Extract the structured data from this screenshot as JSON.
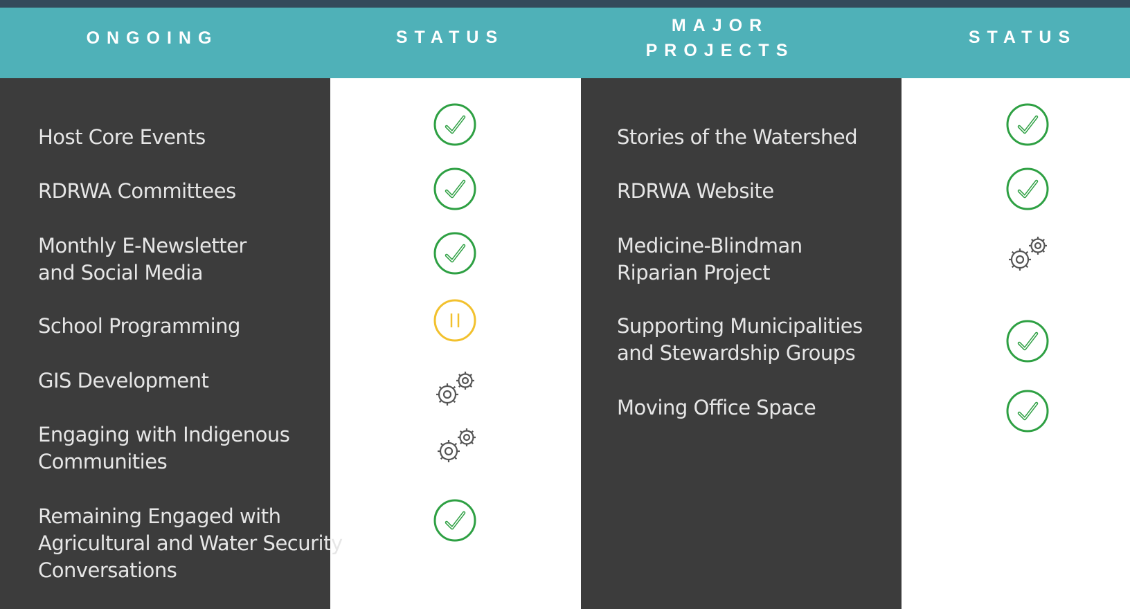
{
  "header": {
    "col1": "ONGOING",
    "col2": "STATUS",
    "col3_line1": "MAJOR",
    "col3_line2": "PROJECTS",
    "col4": "STATUS"
  },
  "colors": {
    "header_bg": "#4fb1b8",
    "top_bar": "#344a5b",
    "dark_panel": "#3c3c3c",
    "complete": "#2ea043",
    "paused": "#f2c12e",
    "in_progress": "#555555"
  },
  "ongoing": [
    {
      "lines": [
        "Host Core Events"
      ],
      "status": "check-icon"
    },
    {
      "lines": [
        "RDRWA Committees"
      ],
      "status": "check-icon"
    },
    {
      "lines": [
        "Monthly E-Newsletter",
        "and Social Media"
      ],
      "status": "check-icon"
    },
    {
      "lines": [
        "School Programming"
      ],
      "status": "pause-icon"
    },
    {
      "lines": [
        "GIS Development"
      ],
      "status": "gears-icon"
    },
    {
      "lines": [
        "Engaging with Indigenous",
        "Communities"
      ],
      "status": "gears-icon"
    },
    {
      "lines": [
        "Remaining Engaged with",
        "Agricultural and Water Security",
        "Conversations"
      ],
      "status": "check-icon"
    }
  ],
  "major_projects": [
    {
      "lines": [
        "Stories of the Watershed"
      ],
      "status": "check-icon"
    },
    {
      "lines": [
        "RDRWA Website"
      ],
      "status": "check-icon"
    },
    {
      "lines": [
        "Medicine-Blindman",
        "Riparian Project"
      ],
      "status": "gears-icon"
    },
    {
      "lines": [
        "Supporting Municipalities",
        "and Stewardship Groups"
      ],
      "status": "check-icon"
    },
    {
      "lines": [
        "Moving Office Space"
      ],
      "status": "check-icon"
    }
  ]
}
